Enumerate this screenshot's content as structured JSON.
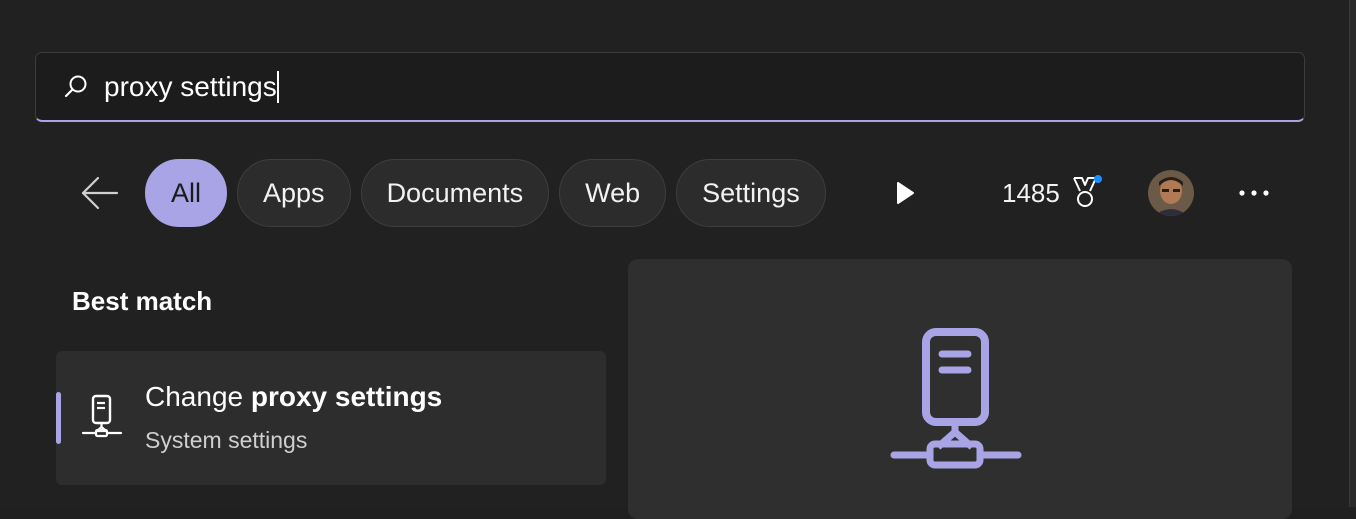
{
  "search": {
    "query": "proxy settings",
    "icon": "search-icon"
  },
  "filters": {
    "back_icon": "arrow-left-icon",
    "chips": [
      {
        "label": "All",
        "active": true
      },
      {
        "label": "Apps",
        "active": false
      },
      {
        "label": "Documents",
        "active": false
      },
      {
        "label": "Web",
        "active": false
      },
      {
        "label": "Settings",
        "active": false
      }
    ],
    "more_icon": "play-arrow-icon"
  },
  "rewards": {
    "points": "1485",
    "icon": "medal-icon",
    "notification_color": "#1a8fff"
  },
  "overflow_icon": "more-horizontal-icon",
  "results": {
    "section_heading": "Best match",
    "best_match": {
      "title_prefix": "Change ",
      "title_match": "proxy settings",
      "subtitle": "System settings",
      "icon": "proxy-server-icon"
    }
  },
  "theme": {
    "accent": "#a9a4e6",
    "background": "#212121"
  }
}
